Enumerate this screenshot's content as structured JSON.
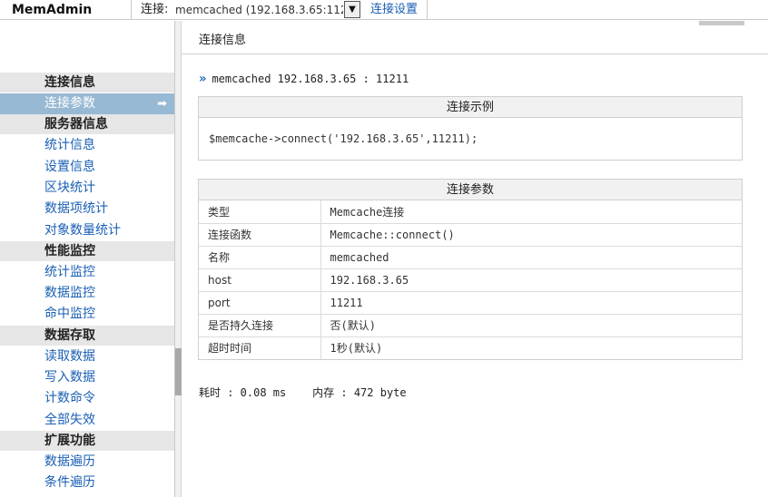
{
  "header": {
    "brand": "MemAdmin",
    "connection_label": "连接:",
    "connection_value": "memcached (192.168.3.65:112",
    "dropdown_arrow": "▼",
    "connection_settings": "连接设置"
  },
  "sidebar": {
    "groups": [
      {
        "title": "连接信息",
        "items": [
          "连接参数"
        ]
      },
      {
        "title": "服务器信息",
        "items": [
          "统计信息",
          "设置信息",
          "区块统计",
          "数据项统计",
          "对象数量统计"
        ]
      },
      {
        "title": "性能监控",
        "items": [
          "统计监控",
          "数据监控",
          "命中监控"
        ]
      },
      {
        "title": "数据存取",
        "items": [
          "读取数据",
          "写入数据",
          "计数命令",
          "全部失效"
        ]
      },
      {
        "title": "扩展功能",
        "items": [
          "数据遍历",
          "条件遍历"
        ]
      }
    ],
    "active_item": "连接参数",
    "active_arrow": "➡"
  },
  "main": {
    "page_title": "连接信息",
    "server_marker": "»",
    "server_line": "memcached 192.168.3.65 : 11211",
    "example": {
      "title": "连接示例",
      "code": "$memcache->connect('192.168.3.65',11211);"
    },
    "params": {
      "title": "连接参数",
      "rows": [
        {
          "key": "类型",
          "value": "Memcache连接"
        },
        {
          "key": "连接函数",
          "value": "Memcache::connect()"
        },
        {
          "key": "名称",
          "value": "memcached"
        },
        {
          "key": "host",
          "value": "192.168.3.65"
        },
        {
          "key": "port",
          "value": "11211"
        },
        {
          "key": "是否持久连接",
          "value": "否(默认)"
        },
        {
          "key": "超时时间",
          "value": "1秒(默认)"
        }
      ]
    },
    "footer": "耗时 : 0.08 ms    内存 : 472 byte"
  }
}
